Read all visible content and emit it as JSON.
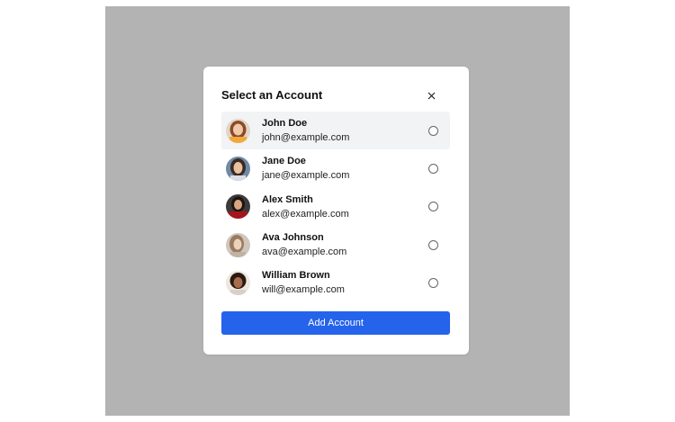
{
  "modal": {
    "title": "Select an Account",
    "close_icon": "close-icon",
    "add_button_label": "Add Account"
  },
  "accounts": [
    {
      "name": "John Doe",
      "email": "john@example.com",
      "selected": false,
      "highlighted": true
    },
    {
      "name": "Jane Doe",
      "email": "jane@example.com",
      "selected": false,
      "highlighted": false
    },
    {
      "name": "Alex Smith",
      "email": "alex@example.com",
      "selected": false,
      "highlighted": false
    },
    {
      "name": "Ava Johnson",
      "email": "ava@example.com",
      "selected": false,
      "highlighted": false
    },
    {
      "name": "William Brown",
      "email": "will@example.com",
      "selected": false,
      "highlighted": false
    }
  ],
  "colors": {
    "overlay": "#b3b3b3",
    "primary_button": "#2563eb",
    "highlight_row": "#f1f3f5"
  }
}
